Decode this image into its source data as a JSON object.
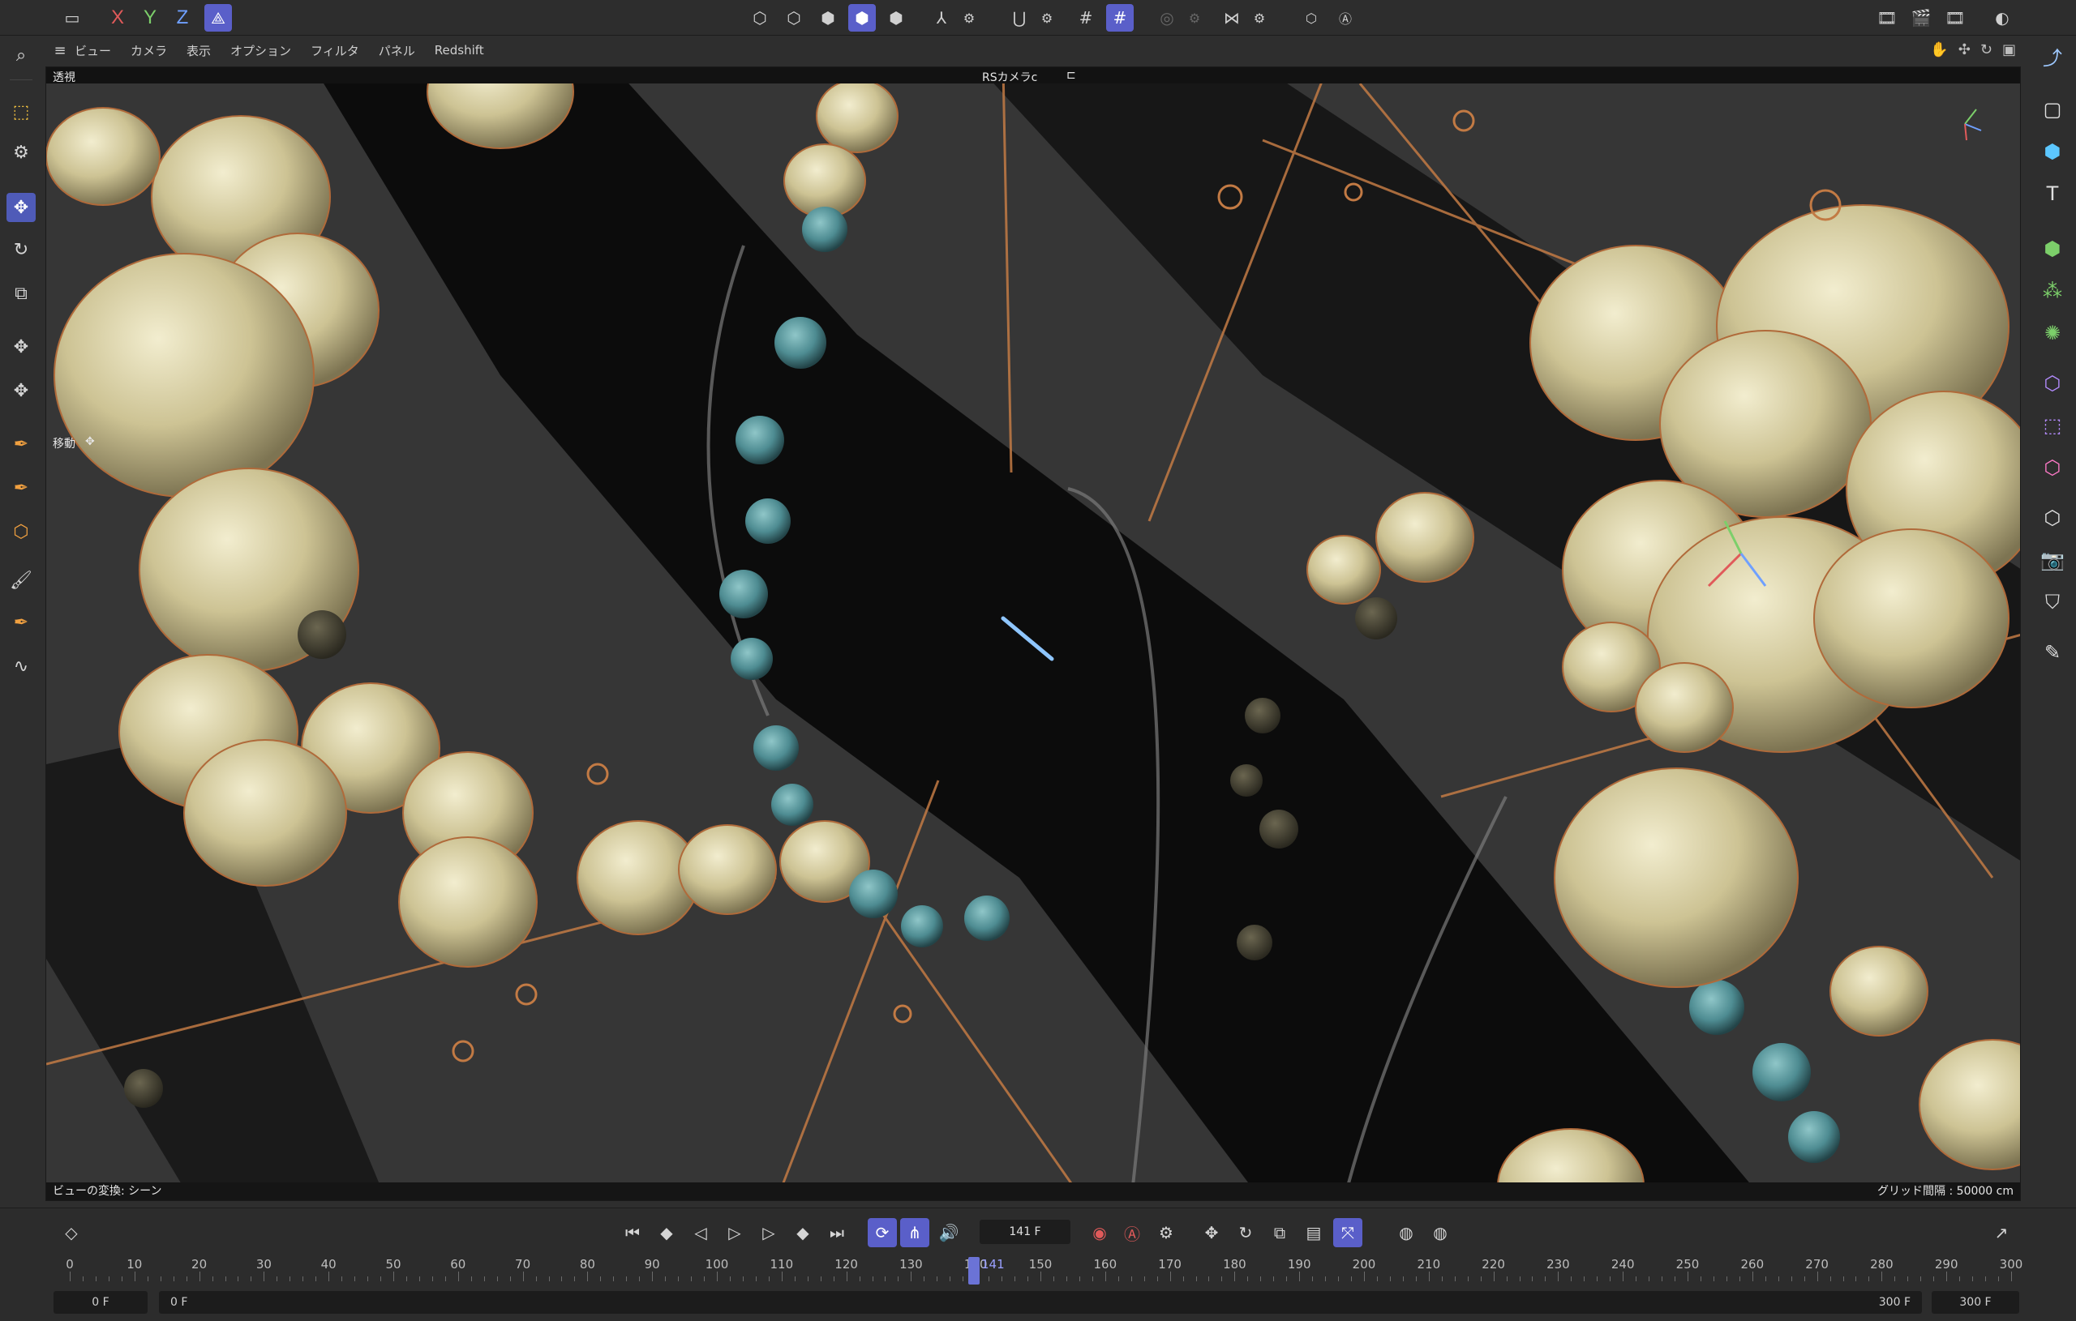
{
  "top_toolbar": {
    "axis_x": "X",
    "axis_y": "Y",
    "axis_z": "Z",
    "colors": {
      "axis_x": "#e05a5a",
      "axis_y": "#7ccf6a",
      "axis_z": "#6fa0ff",
      "accent": "#5a5fc9"
    }
  },
  "viewport_menu": {
    "items": [
      "ビュー",
      "カメラ",
      "表示",
      "オプション",
      "フィルタ",
      "パネル",
      "Redshift"
    ]
  },
  "viewport": {
    "mode_label": "透視",
    "camera_label": "RSカメラc",
    "tool_label": "移動",
    "status_left": "ビューの変換: シーン",
    "grid_label": "グリッド間隔 : 50000 cm"
  },
  "transport": {
    "current_frame": "141 F",
    "ruler_ticks": [
      "0",
      "10",
      "20",
      "30",
      "40",
      "50",
      "60",
      "70",
      "80",
      "90",
      "100",
      "110",
      "120",
      "130",
      "140",
      "150",
      "160",
      "170",
      "180",
      "190",
      "200",
      "210",
      "220",
      "230",
      "240",
      "250",
      "260",
      "270",
      "280",
      "290",
      "300"
    ],
    "playhead_label": "141",
    "start_field": "0 F",
    "range_start": "0 F",
    "range_end": "300 F",
    "end_field": "300 F"
  }
}
